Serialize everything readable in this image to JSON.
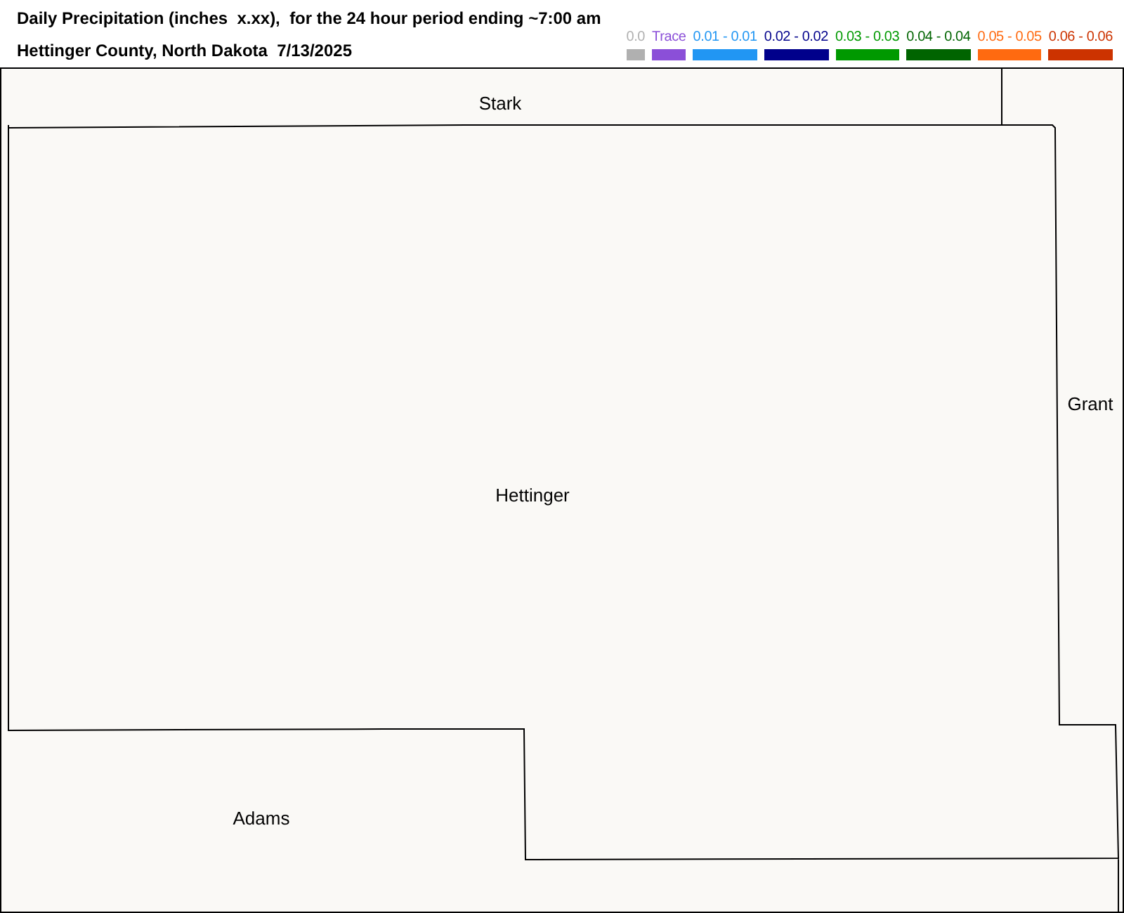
{
  "header": {
    "title": "Daily Precipitation (inches  x.xx),  for the 24 hour period ending ~7:00 am",
    "subtitle": "Hettinger County, North Dakota  7/13/2025"
  },
  "legend": [
    {
      "label": "0.0",
      "color": "#b0b0b0"
    },
    {
      "label": "Trace",
      "color": "#8b4fd8"
    },
    {
      "label": "0.01 - 0.01",
      "color": "#2196f3"
    },
    {
      "label": "0.02 - 0.02",
      "color": "#00008b"
    },
    {
      "label": "0.03 - 0.03",
      "color": "#009900"
    },
    {
      "label": "0.04 - 0.04",
      "color": "#006400"
    },
    {
      "label": "0.05 - 0.05",
      "color": "#ff6a10"
    },
    {
      "label": "0.06 - 0.06",
      "color": "#cc3300"
    }
  ],
  "map": {
    "counties": [
      {
        "name": "Stark"
      },
      {
        "name": "Grant"
      },
      {
        "name": "Hettinger"
      },
      {
        "name": "Adams"
      }
    ]
  }
}
